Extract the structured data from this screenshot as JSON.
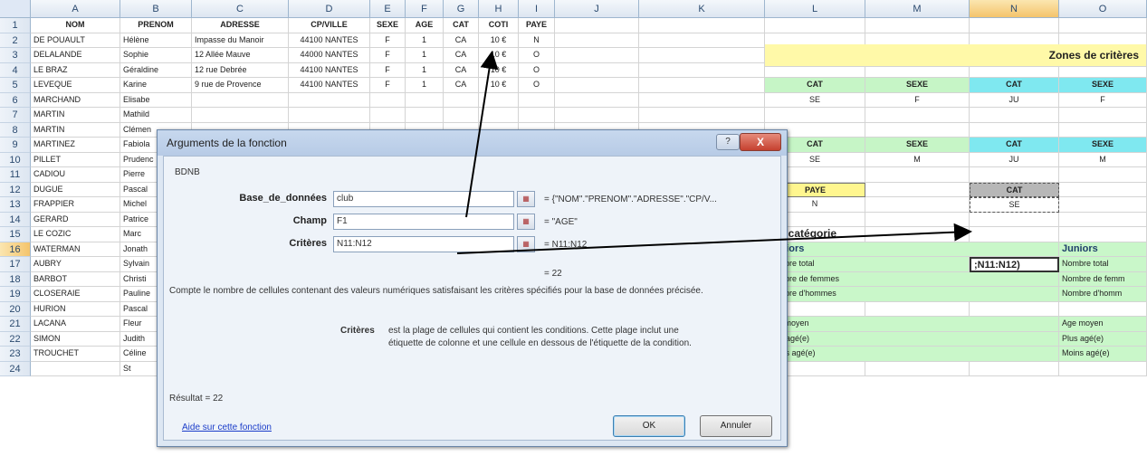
{
  "columns": [
    "A",
    "B",
    "C",
    "D",
    "E",
    "F",
    "G",
    "H",
    "I",
    "J",
    "K",
    "L",
    "M",
    "N",
    "O"
  ],
  "selected_column": "N",
  "selected_row": "16",
  "rows": [
    {
      "n": "1",
      "cells": [
        "NOM",
        "PRENOM",
        "ADRESSE",
        "CP/VILLE",
        "SEXE",
        "AGE",
        "CAT",
        "COTI",
        "PAYE"
      ]
    },
    {
      "n": "2",
      "cells": [
        "DE POUAULT",
        "Hélène",
        "Impasse du Manoir",
        "44100 NANTES",
        "F",
        "1",
        "CA",
        "10 €",
        "N"
      ]
    },
    {
      "n": "3",
      "cells": [
        "DELALANDE",
        "Sophie",
        "12 Allée Mauve",
        "44000 NANTES",
        "F",
        "1",
        "CA",
        "10 €",
        "O"
      ]
    },
    {
      "n": "4",
      "cells": [
        "LE BRAZ",
        "Géraldine",
        "12 rue Debrée",
        "44100 NANTES",
        "F",
        "1",
        "CA",
        "10 €",
        "O"
      ]
    },
    {
      "n": "5",
      "cells": [
        "LEVEQUE",
        "Karine",
        "9 rue de Provence",
        "44100 NANTES",
        "F",
        "1",
        "CA",
        "10 €",
        "O"
      ]
    },
    {
      "n": "6",
      "cells": [
        "MARCHAND",
        "Elisabe"
      ]
    },
    {
      "n": "7",
      "cells": [
        "MARTIN",
        "Mathild"
      ]
    },
    {
      "n": "8",
      "cells": [
        "MARTIN",
        "Clémen"
      ]
    },
    {
      "n": "9",
      "cells": [
        "MARTINEZ",
        "Fabiola"
      ]
    },
    {
      "n": "10",
      "cells": [
        "PILLET",
        "Prudenc"
      ]
    },
    {
      "n": "11",
      "cells": [
        "CADIOU",
        "Pierre"
      ]
    },
    {
      "n": "12",
      "cells": [
        "DUGUE",
        "Pascal"
      ]
    },
    {
      "n": "13",
      "cells": [
        "FRAPPIER",
        "Michel"
      ]
    },
    {
      "n": "14",
      "cells": [
        "GERARD",
        "Patrice"
      ]
    },
    {
      "n": "15",
      "cells": [
        "LE COZIC",
        "Marc"
      ]
    },
    {
      "n": "16",
      "cells": [
        "WATERMAN",
        "Jonath"
      ]
    },
    {
      "n": "17",
      "cells": [
        "AUBRY",
        "Sylvain"
      ]
    },
    {
      "n": "18",
      "cells": [
        "BARBOT",
        "Christi"
      ]
    },
    {
      "n": "19",
      "cells": [
        "CLOSERAIE",
        "Pauline"
      ]
    },
    {
      "n": "20",
      "cells": [
        "HURION",
        "Pascal"
      ]
    },
    {
      "n": "21",
      "cells": [
        "LACANA",
        "Fleur"
      ]
    },
    {
      "n": "22",
      "cells": [
        "SIMON",
        "Judith"
      ]
    },
    {
      "n": "23",
      "cells": [
        "TROUCHET",
        "Céline"
      ]
    },
    {
      "n": "24",
      "cells": [
        "",
        "St"
      ]
    }
  ],
  "zones": {
    "title": "Zones de critères",
    "row4": [
      "CAT",
      "SEXE",
      "CAT",
      "SEXE"
    ],
    "row5": [
      "SE",
      "F",
      "JU",
      "F"
    ],
    "row8": [
      "CAT",
      "SEXE",
      "CAT",
      "SEXE"
    ],
    "row9": [
      "SE",
      "M",
      "JU",
      "M"
    ],
    "paye_label": "PAYE",
    "paye_value": "N",
    "cat_label": "CAT",
    "cat_value": "SE"
  },
  "categorie": {
    "title": "Par catégorie",
    "seniors": "Séniors",
    "juniors": "Juniors",
    "nombre_total": "Nombre total",
    "nombre_femmes": "Nombre de femmes",
    "nombre_hommes": "Nombre d'hommes",
    "formula_fragment": ";N11:N12)",
    "age_moyen": "Age moyen",
    "plus_age": "Plus agé(e)",
    "moins_age": "Moins agé(e)",
    "j_nombre_total": "Nombre total",
    "j_nombre_femmes": "Nombre de femm",
    "j_nombre_hommes": "Nombre d'homm",
    "j_age_moyen": "Age moyen",
    "j_plus_age": "Plus agé(e)",
    "j_moins_age": "Moins agé(e)"
  },
  "dialog": {
    "title": "Arguments de la fonction",
    "help_btn": "?",
    "close_btn": "X",
    "function_name": "BDNB",
    "args": [
      {
        "label": "Base_de_données",
        "value": "club",
        "eval": "= {\"NOM\".\"PRENOM\".\"ADRESSE\".\"CP/V..."
      },
      {
        "label": "Champ",
        "value": "F1",
        "eval": "= \"AGE\""
      },
      {
        "label": "Critères",
        "value": "N11:N12",
        "eval": "= N11:N12"
      }
    ],
    "result_eq": "= 22",
    "description": "Compte le nombre de cellules contenant des valeurs numériques satisfaisant les critères spécifiés pour la base de données précisée.",
    "arg_name": "Critères",
    "arg_desc_1": "est la plage de cellules qui contient les conditions. Cette plage inclut une",
    "arg_desc_2": "étiquette de colonne et une cellule en dessous de l'étiquette de la condition.",
    "result_label": "Résultat =  22",
    "help_link": "Aide sur cette fonction",
    "ok": "OK",
    "cancel": "Annuler"
  },
  "colors": {
    "zone_band": "#fff9a8",
    "green": "#c6f5c6",
    "cyan": "#7fe8f0",
    "dialog": "#dde7f3"
  }
}
